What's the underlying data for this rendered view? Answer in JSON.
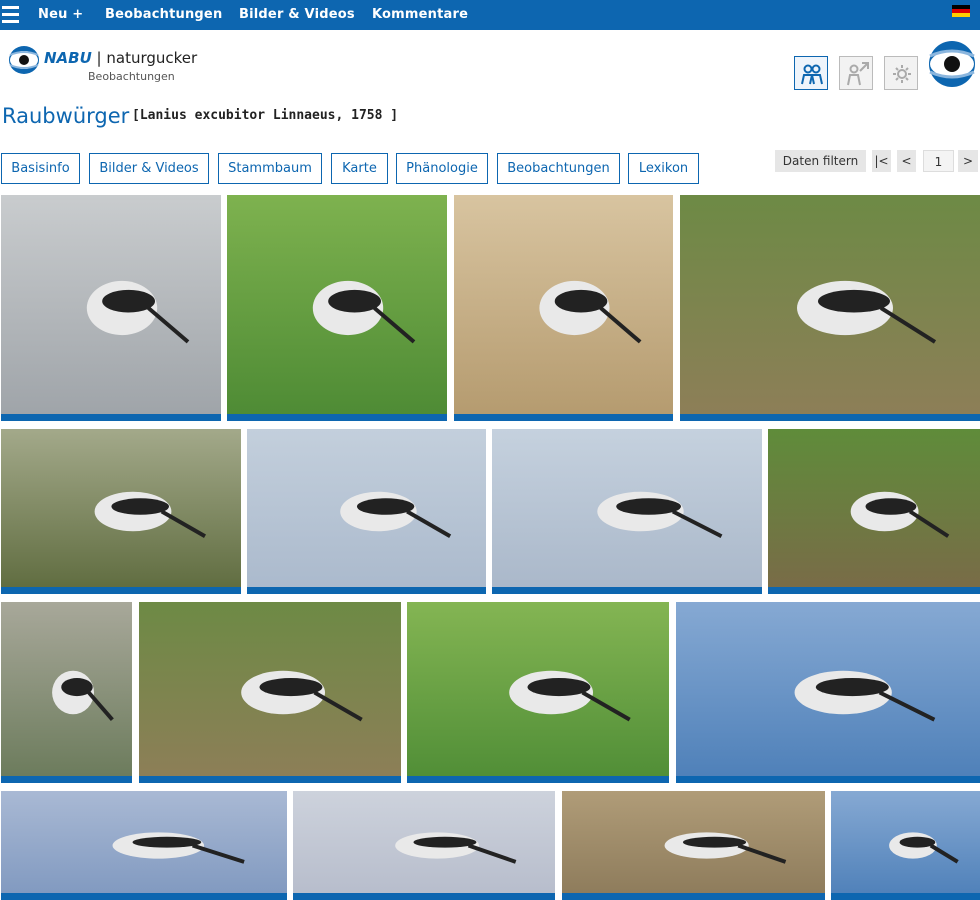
{
  "nav": {
    "items": [
      "Neu +",
      "Beobachtungen",
      "Bilder & Videos",
      "Kommentare"
    ],
    "language": "de"
  },
  "logo": {
    "brand": "NABU",
    "name": "naturgucker",
    "subtitle": "Beobachtungen"
  },
  "util_icons": [
    "group-icon",
    "person-share-icon",
    "settings-icon"
  ],
  "species": {
    "common_name": "Raubwürger",
    "scientific": "[Lanius excubitor Linnaeus, 1758 ]"
  },
  "tabs": [
    "Basisinfo",
    "Bilder & Videos",
    "Stammbaum",
    "Karte",
    "Phänologie",
    "Beobachtungen",
    "Lexikon"
  ],
  "pager": {
    "filter_label": "Daten filtern",
    "first": "|<",
    "prev": "<",
    "page": "1",
    "next": ">"
  },
  "colors": {
    "primary": "#0d66b0",
    "white": "#ffffff"
  },
  "gallery": {
    "photos": [
      {
        "scene": "perched-annotated"
      },
      {
        "scene": "with-prey-annotated"
      },
      {
        "scene": "perched-reeds"
      },
      {
        "scene": "perched-post"
      },
      {
        "scene": "flying-branches"
      },
      {
        "scene": "flight-sequence"
      },
      {
        "scene": "flying-with-prey"
      },
      {
        "scene": "flying-meadow"
      },
      {
        "scene": "perched-twig"
      },
      {
        "scene": "perched-post"
      },
      {
        "scene": "with-prey-grass"
      },
      {
        "scene": "flying-blue-sky"
      },
      {
        "scene": "perched-branches"
      },
      {
        "scene": "flying-grey-sky"
      },
      {
        "scene": "perched-field"
      },
      {
        "scene": "flying-blue-sky"
      }
    ]
  }
}
